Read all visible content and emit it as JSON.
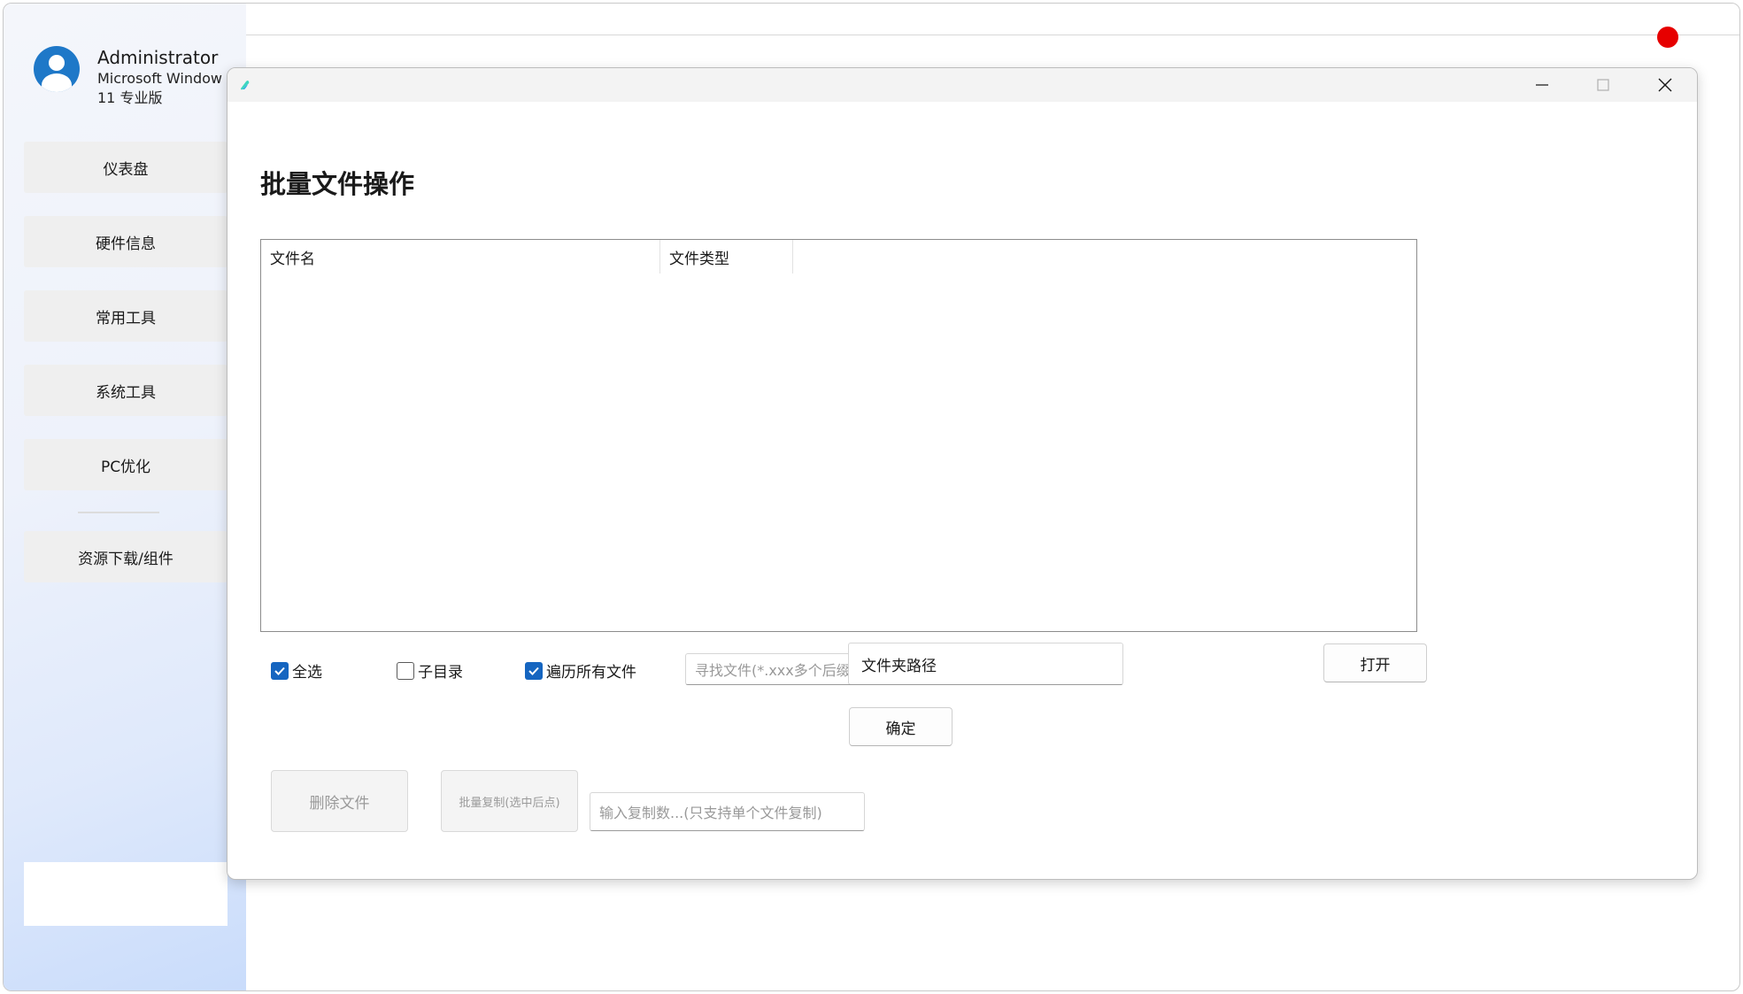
{
  "user": {
    "name": "Administrator",
    "os_line1": "Microsoft Window",
    "os_line2": "11 专业版"
  },
  "sidebar": {
    "items": [
      {
        "label": "仪表盘"
      },
      {
        "label": "硬件信息"
      },
      {
        "label": "常用工具"
      },
      {
        "label": "系统工具"
      },
      {
        "label": "PC优化"
      },
      {
        "label": "资源下载/组件"
      }
    ]
  },
  "dialog": {
    "title": "批量文件操作",
    "table": {
      "columns": [
        "文件名",
        "文件类型"
      ],
      "rows": []
    },
    "checkboxes": {
      "select_all": {
        "label": "全选",
        "checked": true
      },
      "subdirectory": {
        "label": "子目录",
        "checked": false
      },
      "traverse_all": {
        "label": "遍历所有文件",
        "checked": true
      }
    },
    "search": {
      "placeholder": "寻找文件(*.xxx多个后缀|隔开)"
    },
    "folder_path": {
      "value": "文件夹路径"
    },
    "buttons": {
      "open": "打开",
      "confirm": "确定",
      "delete": "删除文件",
      "batch_copy": "批量复制(选中后点)"
    },
    "copy_count": {
      "placeholder": "输入复制数...(只支持单个文件复制)"
    }
  },
  "colors": {
    "accent": "#1565c0",
    "status_dot": "#e60000",
    "avatar": "#1e78c8"
  },
  "icons": [
    "user-avatar-icon",
    "app-icon",
    "minimize-icon",
    "maximize-icon",
    "close-icon",
    "checkmark-icon"
  ]
}
